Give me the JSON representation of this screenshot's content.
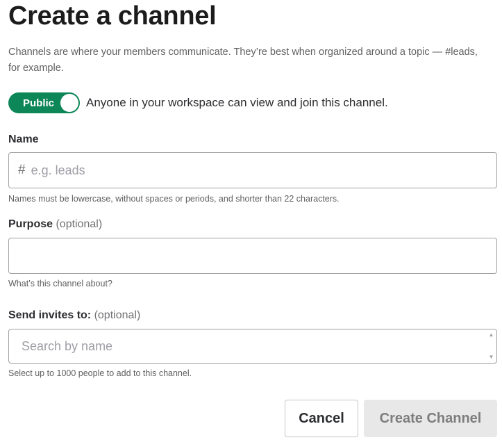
{
  "dialog": {
    "title": "Create a channel",
    "intro": "Channels are where your members communicate. They’re best when organized around a topic — #leads, for example."
  },
  "visibility": {
    "toggle_label": "Public",
    "toggle_on": true,
    "description": "Anyone in your workspace can view and join this channel.",
    "accent_color": "#0d8658"
  },
  "name_field": {
    "label": "Name",
    "prefix_icon": "hash-icon",
    "prefix": "#",
    "value": "",
    "placeholder": "e.g. leads",
    "hint": "Names must be lowercase, without spaces or periods, and shorter than 22 characters."
  },
  "purpose_field": {
    "label": "Purpose",
    "optional": "(optional)",
    "value": "",
    "placeholder": "",
    "hint": "What’s this channel about?"
  },
  "invite_field": {
    "label": "Send invites to:",
    "optional": "(optional)",
    "value": "",
    "placeholder": "Search by name",
    "hint": "Select up to 1000 people to add to this channel."
  },
  "actions": {
    "cancel_label": "Cancel",
    "create_label": "Create Channel",
    "create_enabled": false
  }
}
